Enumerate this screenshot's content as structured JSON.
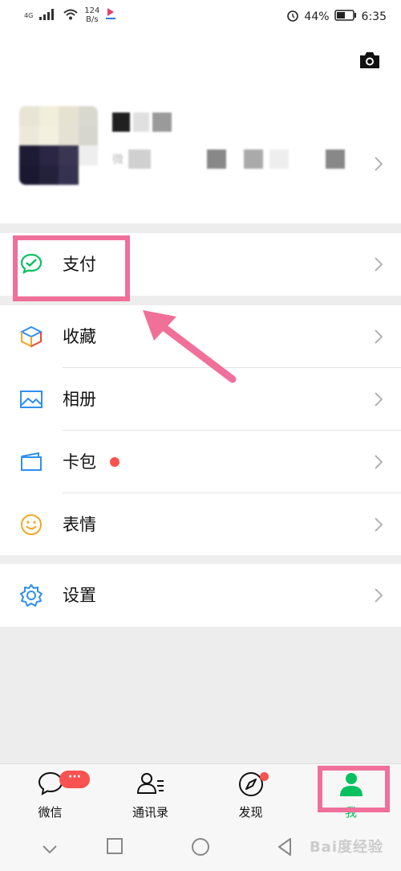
{
  "status_bar": {
    "network": "4G",
    "speed_value": "124",
    "speed_unit": "B/s",
    "battery": "44%",
    "time": "6:35"
  },
  "profile": {
    "wxid_prefix": "微"
  },
  "menu": {
    "pay": "支付",
    "favorites": "收藏",
    "album": "相册",
    "cards": "卡包",
    "stickers": "表情",
    "settings": "设置"
  },
  "tabbar": {
    "chats": "微信",
    "chats_badge": "···",
    "contacts": "通讯录",
    "discover": "发现",
    "me": "我"
  },
  "watermark": "Bai度经验",
  "colors": {
    "accent_green": "#07c160",
    "badge_red": "#fa5151",
    "annotation_pink": "#f0709a"
  }
}
